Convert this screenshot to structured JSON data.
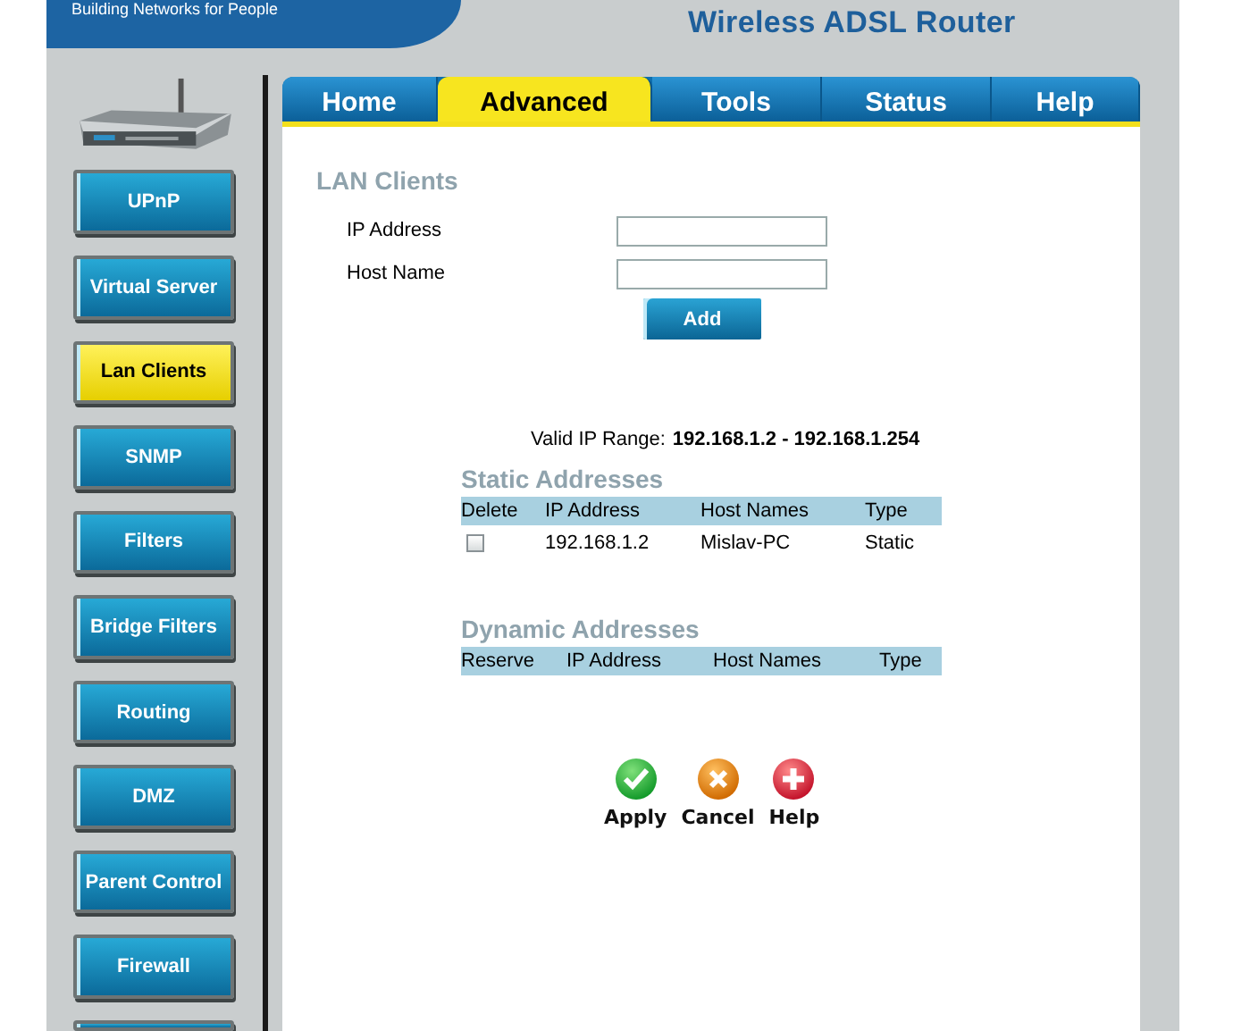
{
  "header": {
    "tagline": "Building Networks for People",
    "title": "Wireless ADSL Router"
  },
  "tabs": [
    {
      "label": "Home",
      "selected": false
    },
    {
      "label": "Advanced",
      "selected": true
    },
    {
      "label": "Tools",
      "selected": false
    },
    {
      "label": "Status",
      "selected": false
    },
    {
      "label": "Help",
      "selected": false
    }
  ],
  "sidebar": {
    "items": [
      {
        "label": "UPnP",
        "selected": false
      },
      {
        "label": "Virtual Server",
        "selected": false
      },
      {
        "label": "Lan Clients",
        "selected": true
      },
      {
        "label": "SNMP",
        "selected": false
      },
      {
        "label": "Filters",
        "selected": false
      },
      {
        "label": "Bridge Filters",
        "selected": false
      },
      {
        "label": "Routing",
        "selected": false
      },
      {
        "label": "DMZ",
        "selected": false
      },
      {
        "label": "Parent Control",
        "selected": false
      },
      {
        "label": "Firewall",
        "selected": false
      }
    ]
  },
  "lan_clients": {
    "title": "LAN Clients",
    "fields": [
      {
        "label": "IP Address"
      },
      {
        "label": "Host Name"
      }
    ],
    "add_button": "Add"
  },
  "valid_range": {
    "label": "Valid IP Range:",
    "value": "192.168.1.2 -  192.168.1.254"
  },
  "static_addresses": {
    "title": "Static Addresses",
    "columns": [
      "Delete",
      "IP Address",
      "Host Names",
      "Type"
    ],
    "rows": [
      {
        "checked": false,
        "ip_address": "192.168.1.2",
        "host_name": "Mislav-PC",
        "type": "Static"
      }
    ]
  },
  "dynamic_addresses": {
    "title": "Dynamic Addresses",
    "columns": [
      "Reserve",
      "IP Address",
      "Host Names",
      "Type"
    ]
  },
  "actions": [
    {
      "label": "Apply",
      "kind": "apply"
    },
    {
      "label": "Cancel",
      "kind": "cancel"
    },
    {
      "label": "Help",
      "kind": "help"
    }
  ]
}
